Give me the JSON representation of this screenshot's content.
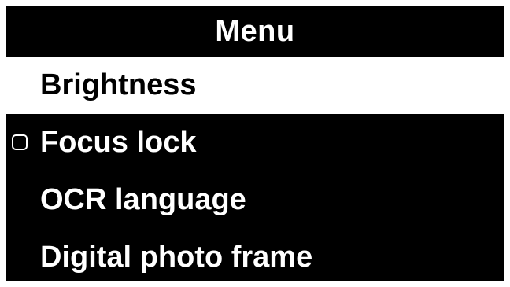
{
  "menu": {
    "title": "Menu",
    "items": [
      {
        "label": "Brightness",
        "selected": true,
        "has_checkbox": false
      },
      {
        "label": "Focus lock",
        "selected": false,
        "has_checkbox": true,
        "checked": false
      },
      {
        "label": "OCR language",
        "selected": false,
        "has_checkbox": false
      },
      {
        "label": "Digital photo frame",
        "selected": false,
        "has_checkbox": false
      }
    ]
  },
  "colors": {
    "background": "#000000",
    "foreground": "#ffffff",
    "highlight_background": "#ffffff",
    "highlight_foreground": "#000000"
  }
}
